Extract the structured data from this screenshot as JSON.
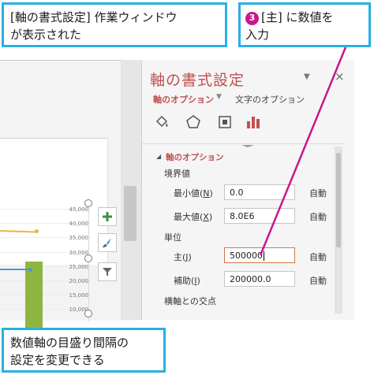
{
  "callouts": {
    "top": {
      "line1": "[軸の書式設定] 作業ウィンドウ",
      "line2": "が表示された"
    },
    "step": {
      "number": "3",
      "line1": "[主] に数値を",
      "line2": "入力",
      "color": "#c8178c"
    },
    "bottom": {
      "line1": "数値軸の目盛り間隔の",
      "line2": "設定を変更できる"
    },
    "border_color": "#28b0e3"
  },
  "chart": {
    "y_ticks": [
      "45,000",
      "40,000",
      "35,000",
      "30,000",
      "25,000",
      "20,000",
      "15,000",
      "10,000"
    ],
    "bar_color": "#8db640",
    "series_colors": [
      "#f0b341",
      "#5a8fd0"
    ],
    "side_buttons": [
      {
        "icon": "plus-icon"
      },
      {
        "icon": "brush-icon"
      },
      {
        "icon": "filter-icon"
      }
    ]
  },
  "pane": {
    "title": "軸の書式設定",
    "menu_caret": "▼",
    "close": "×",
    "tab_axis": "軸のオプション",
    "tab_caret": "▼",
    "tab_text": "文字のオプション",
    "icons": [
      "fill-icon",
      "pentagon-icon",
      "size-icon",
      "bar-chart-icon"
    ],
    "accent": "#c0504d",
    "section_tri": "◢",
    "section": "軸のオプション",
    "bounds_label": "境界値",
    "min_label": "最小値",
    "min_key": "N",
    "min_value": "0.0",
    "max_label": "最大値",
    "max_key": "X",
    "max_value": "8.0E6",
    "units_label": "単位",
    "major_label": "主",
    "major_key": "J",
    "major_value": "500000",
    "minor_label": "補助",
    "minor_key": "I",
    "minor_value": "200000.0",
    "auto": "自動",
    "cross_label": "横軸との交点"
  }
}
